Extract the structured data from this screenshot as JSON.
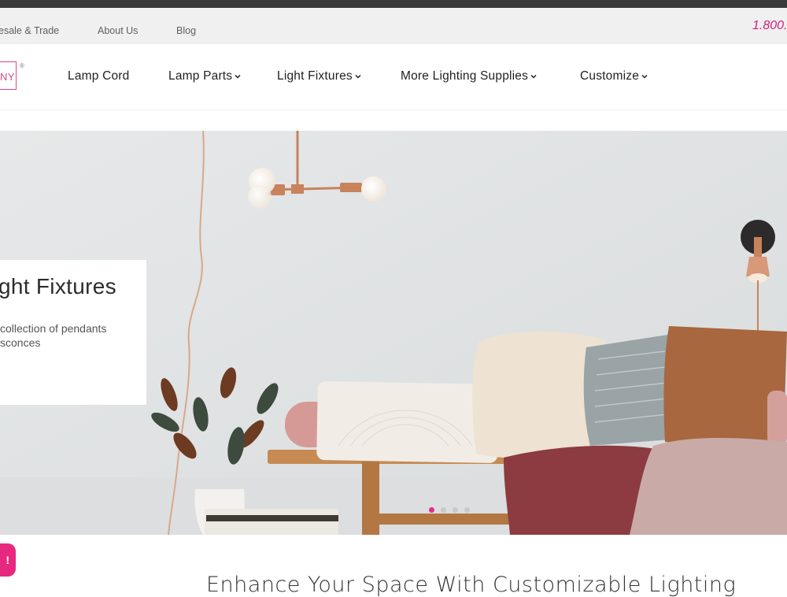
{
  "utility": {
    "links": [
      "esale & Trade",
      "About Us",
      "Blog"
    ],
    "phone": "1.800."
  },
  "header": {
    "logo_text": "NY",
    "logo_reg": "®",
    "nav": [
      "Lamp Cord",
      "Lamp Parts",
      "Light Fixtures",
      "More Lighting Supplies",
      "Customize"
    ]
  },
  "hero": {
    "title": "ght Fixtures",
    "line1": "collection of pendants",
    "line2": "sconces",
    "slide_count": 4,
    "active_slide": 1
  },
  "chat": {
    "label": "!"
  },
  "section": {
    "heading": "Enhance Your Space With Customizable Lighting"
  },
  "colors": {
    "accent": "#e32d8a",
    "phone": "#d11f7a",
    "utility_bg": "#f0f0f0"
  },
  "icons": {
    "dropdown": "chevron-down-icon"
  }
}
